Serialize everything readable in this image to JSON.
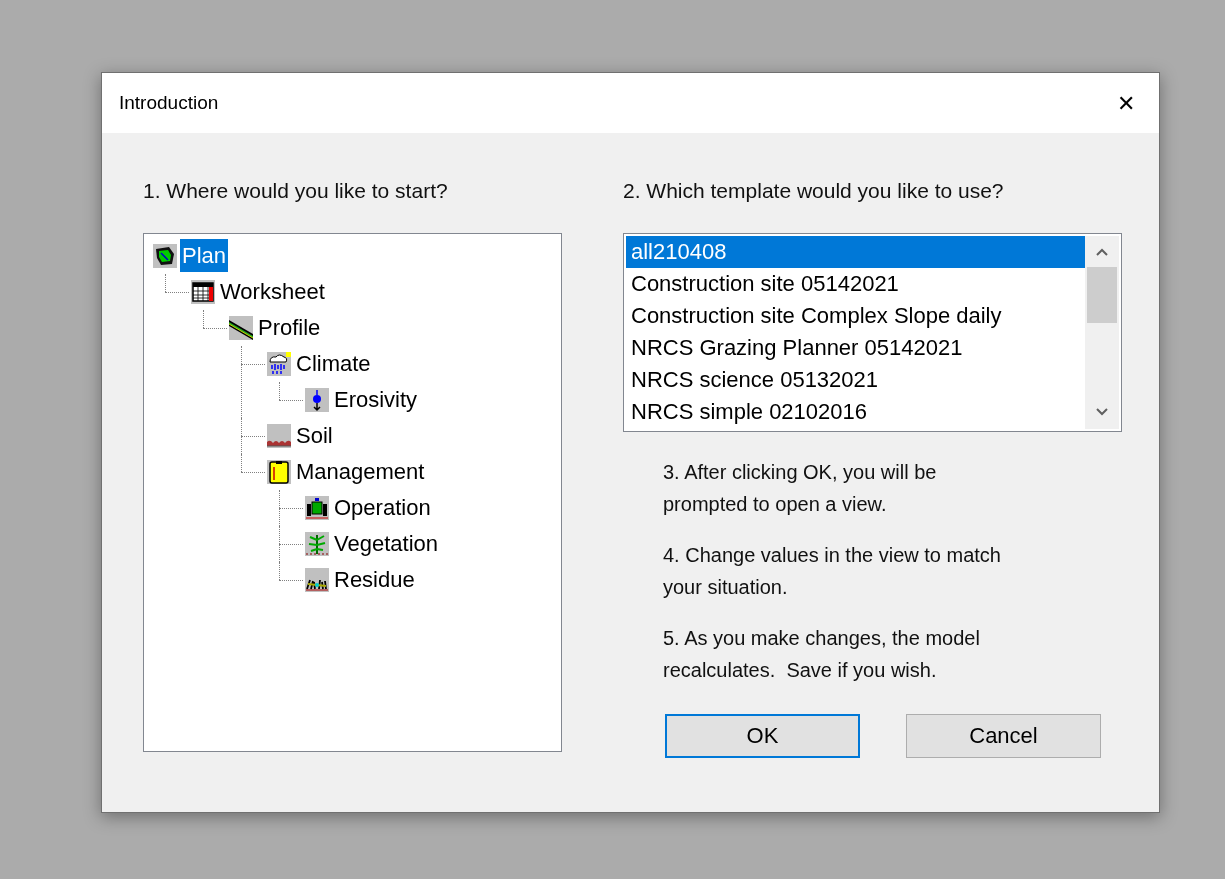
{
  "window": {
    "title": "Introduction",
    "close": "✕"
  },
  "start": {
    "heading": "1. Where would you like to start?",
    "tree": [
      {
        "label": "Plan",
        "kind": "plan",
        "selected": true,
        "children": [
          {
            "label": "Worksheet",
            "kind": "worksheet",
            "selected": false,
            "children": [
              {
                "label": "Profile",
                "kind": "profile",
                "selected": false,
                "children": [
                  {
                    "label": "Climate",
                    "kind": "climate",
                    "selected": false,
                    "children": [
                      {
                        "label": "Erosivity",
                        "kind": "erosivity",
                        "selected": false
                      }
                    ]
                  },
                  {
                    "label": "Soil",
                    "kind": "soil",
                    "selected": false
                  },
                  {
                    "label": "Management",
                    "kind": "management",
                    "selected": false,
                    "children": [
                      {
                        "label": "Operation",
                        "kind": "operation",
                        "selected": false
                      },
                      {
                        "label": "Vegetation",
                        "kind": "vegetation",
                        "selected": false
                      },
                      {
                        "label": "Residue",
                        "kind": "residue",
                        "selected": false
                      }
                    ]
                  }
                ]
              }
            ]
          }
        ]
      }
    ]
  },
  "template": {
    "heading": "2. Which template would you like to use?",
    "items": [
      {
        "label": "all210408",
        "selected": true
      },
      {
        "label": "Construction site 05142021",
        "selected": false
      },
      {
        "label": "Construction site Complex Slope daily",
        "selected": false
      },
      {
        "label": "NRCS Grazing Planner 05142021",
        "selected": false
      },
      {
        "label": "NRCS science 05132021",
        "selected": false
      },
      {
        "label": "NRCS simple 02102016",
        "selected": false
      }
    ]
  },
  "steps": [
    "3. After clicking OK, you will be prompted to open a view.",
    "4. Change values in the view to match your situation.",
    "5. As you make changes, the model recalculates.  Save if you wish."
  ],
  "buttons": [
    {
      "label": "OK",
      "default": true
    },
    {
      "label": "Cancel",
      "default": false
    }
  ]
}
